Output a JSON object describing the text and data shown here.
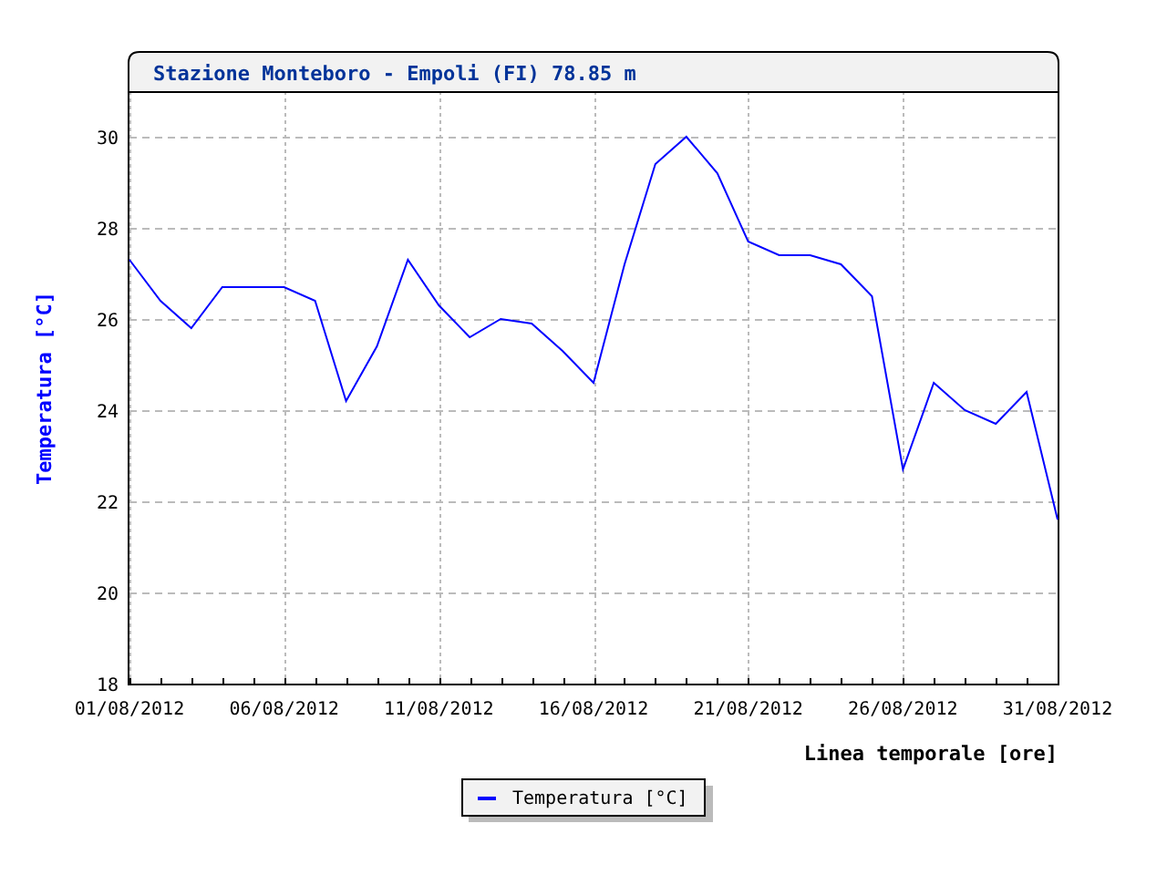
{
  "chart": {
    "title": "Stazione Monteboro - Empoli (FI) 78.85 m",
    "chart_data": {
      "type": "line",
      "xlabel": "Linea temporale [ore]",
      "ylabel": "Temperatura [°C]",
      "categories": [
        "01/08/2012",
        null,
        null,
        null,
        null,
        "06/08/2012",
        null,
        null,
        null,
        null,
        "11/08/2012",
        null,
        null,
        null,
        null,
        "16/08/2012",
        null,
        null,
        null,
        null,
        "21/08/2012",
        null,
        null,
        null,
        null,
        "26/08/2012",
        null,
        null,
        null,
        null,
        "31/08/2012"
      ],
      "ylim": [
        18,
        31
      ],
      "grid": true,
      "yticks": [
        18,
        20,
        22,
        24,
        26,
        28,
        30
      ],
      "series": [
        {
          "name": "Temperatura [°C]",
          "color": "#0000ff",
          "values": [
            27.3,
            26.4,
            25.8,
            26.7,
            26.7,
            26.7,
            26.4,
            24.2,
            25.4,
            27.3,
            26.3,
            25.6,
            26.0,
            25.9,
            25.3,
            24.6,
            27.2,
            29.4,
            30.0,
            29.2,
            27.7,
            27.4,
            27.4,
            27.2,
            26.5,
            22.7,
            24.6,
            24.0,
            23.7,
            24.4,
            21.6
          ]
        }
      ]
    }
  }
}
